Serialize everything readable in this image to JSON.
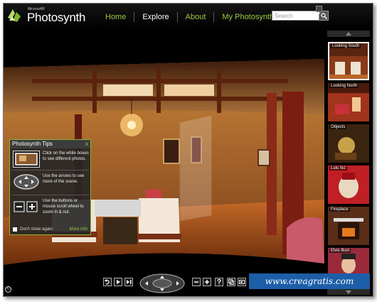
{
  "brand": {
    "small": "Microsoft®",
    "name": "Photosynth"
  },
  "nav": {
    "items": [
      "Home",
      "Explore",
      "About",
      "My Photosynths"
    ]
  },
  "search": {
    "placeholder": "Search"
  },
  "tips": {
    "title": "Photosynth Tips",
    "close": "x",
    "items": [
      {
        "icon": "photo-thumbnail-icon",
        "text": "Click on the white boxes to see different photos."
      },
      {
        "icon": "navigation-arrows-icon",
        "text": "Use the arrows to see more of the scene."
      },
      {
        "icon": "zoom-buttons-icon",
        "text": "Use the buttons or mouse scroll wheel to zoom in & out."
      }
    ],
    "dont_show": "Don't show again",
    "more_info": "More Info"
  },
  "thumbnails": [
    {
      "label": "Looking South",
      "selected": true
    },
    {
      "label": "Looking North",
      "selected": false
    },
    {
      "label": "Objects",
      "selected": false
    },
    {
      "label": "Lulu fez",
      "selected": false
    },
    {
      "label": "Fireplace",
      "selected": false
    },
    {
      "label": "Elvis Bust",
      "selected": false
    }
  ],
  "controls": {
    "icons": [
      "undo-icon",
      "play-icon",
      "next-icon",
      "dpad-icon",
      "zoom-out-icon",
      "zoom-in-icon",
      "help-icon",
      "fullscreen-icon",
      "embed-icon"
    ]
  },
  "copyright_symbol": "©",
  "watermark": "www.creagratis.com",
  "colors": {
    "accent": "#9ac841",
    "background": "#000000",
    "watermark": "#1d5ea8"
  }
}
